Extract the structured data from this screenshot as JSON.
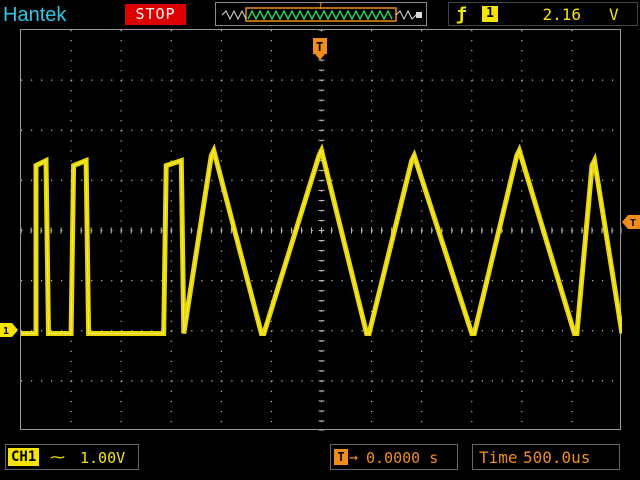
{
  "header": {
    "brand": "Hantek",
    "run_state": "STOP",
    "trigger_marker_letter": "T"
  },
  "trigger": {
    "edge_icon": "rising-edge-icon",
    "source": "1",
    "level": "2.16",
    "unit": "V"
  },
  "channel": {
    "label": "CH1",
    "coupling_icon": "dc-coupling-icon",
    "volts_per_div": "1.00V",
    "marker": "1"
  },
  "timebase": {
    "trigger_icon_letter": "T",
    "arrow": "→",
    "position": "0.0000 s",
    "label": "Time",
    "time_per_div": "500.0us"
  },
  "colors": {
    "trace": "#f5e400",
    "trigger": "#f08c1a",
    "brand": "#2ec7e8",
    "stop_bg": "#d00000",
    "grid": "#bdbdbd"
  },
  "chart_data": {
    "type": "line",
    "grid": {
      "h_divisions": 12,
      "v_divisions": 8
    },
    "series": [
      {
        "x_div": [
          0,
          0.3,
          0.3,
          0.5,
          0.55,
          1.0,
          1.05,
          1.3,
          1.35,
          2.0,
          2.05,
          2.85,
          2.9,
          3.2,
          3.25,
          3.8,
          3.85,
          4.8,
          4.85,
          5.95,
          6.0,
          6.9,
          6.95,
          7.8,
          7.85,
          9.0,
          9.05,
          9.9,
          9.95,
          11.05,
          11.1,
          11.4,
          11.45,
          12.0
        ],
        "y_div": [
          -0.05,
          -0.05,
          3.3,
          3.4,
          -0.05,
          -0.05,
          3.3,
          3.4,
          -0.05,
          -0.05,
          -0.05,
          -0.05,
          3.3,
          3.4,
          -0.05,
          3.5,
          3.6,
          -0.05,
          -0.05,
          3.5,
          3.6,
          -0.05,
          -0.05,
          3.4,
          3.5,
          -0.05,
          -0.05,
          3.5,
          3.6,
          -0.05,
          -0.05,
          3.3,
          3.4,
          -0.05
        ]
      }
    ]
  }
}
